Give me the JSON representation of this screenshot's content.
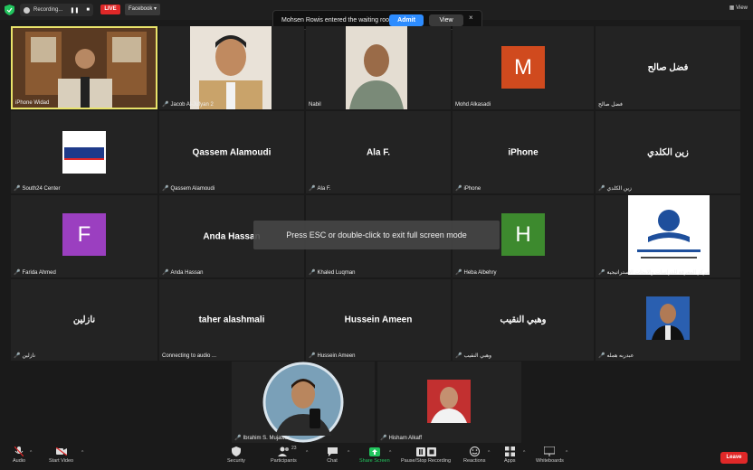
{
  "topbar": {
    "recording_label": "Recording...",
    "pause_icon": "pause-icon",
    "stop_icon": "stop-icon",
    "live_label": "LIVE",
    "facebook_label": "Facebook",
    "view_label": "View"
  },
  "notification": {
    "message": "Mohsen Rowis entered the waiting room",
    "admit_label": "Admit",
    "view_label": "View",
    "close_label": "×"
  },
  "participants": [
    {
      "name": "iPhone Widad",
      "display": "",
      "type": "video"
    },
    {
      "name": "Jacob Al-Jufyan 2",
      "display": "",
      "type": "video"
    },
    {
      "name": "Nabil",
      "display": "",
      "type": "video"
    },
    {
      "name": "Mohd Alkasadi",
      "display": "M",
      "type": "letter",
      "color": "#d04a1e"
    },
    {
      "name": "فضل صالح",
      "display": "فضل صالح",
      "type": "name"
    },
    {
      "name": "South24 Center",
      "display": "SOUTH24",
      "type": "logo"
    },
    {
      "name": "Qassem Alamoudi",
      "display": "Qassem Alamoudi",
      "type": "name"
    },
    {
      "name": "Ala F.",
      "display": "Ala F.",
      "type": "name"
    },
    {
      "name": "iPhone",
      "display": "iPhone",
      "type": "name"
    },
    {
      "name": "زين الكلدي",
      "display": "زين الكلدي",
      "type": "name"
    },
    {
      "name": "Farida Ahmed",
      "display": "F",
      "type": "letter",
      "color": "#9b3fc0"
    },
    {
      "name": "Anda Hassan",
      "display": "Anda Hassan",
      "type": "name"
    },
    {
      "name": "Khaled Luqman",
      "display": "",
      "type": "name"
    },
    {
      "name": "Heba Albehry",
      "display": "H",
      "type": "letter",
      "color": "#3d8a2e"
    },
    {
      "name": "مركز المعرفة للدراسات والابحاث الاستراتيجية",
      "display": "",
      "type": "logo2"
    },
    {
      "name": "نازلين",
      "display": "نازلين",
      "type": "name"
    },
    {
      "name": "Connecting to audio ...",
      "display": "taher alashmali",
      "type": "name"
    },
    {
      "name": "Hussein Ameen",
      "display": "Hussein Ameen",
      "type": "name"
    },
    {
      "name": "وهبي النقيب",
      "display": "وهبي النقيب",
      "type": "name"
    },
    {
      "name": "عبدربه همله",
      "display": "",
      "type": "photo"
    },
    {
      "name": "Ibrahim S. Mujawar",
      "display": "",
      "type": "video"
    },
    {
      "name": "Hisham Alkaff",
      "display": "",
      "type": "photo"
    }
  ],
  "fullscreen_banner": "Press ESC or double-click to exit full screen mode",
  "toolbar": {
    "audio": "Audio",
    "start_video": "Start Video",
    "security": "Security",
    "participants": "Participants",
    "participants_count": "23",
    "chat": "Chat",
    "share_screen": "Share Screen",
    "recording": "Pause/Stop Recording",
    "reactions": "Reactions",
    "apps": "Apps",
    "whiteboards": "Whiteboards",
    "leave": "Leave"
  },
  "colors": {
    "accent": "#2d8cff",
    "danger": "#e02828",
    "active_speaker": "#e8e36a",
    "share": "#22c55e"
  }
}
